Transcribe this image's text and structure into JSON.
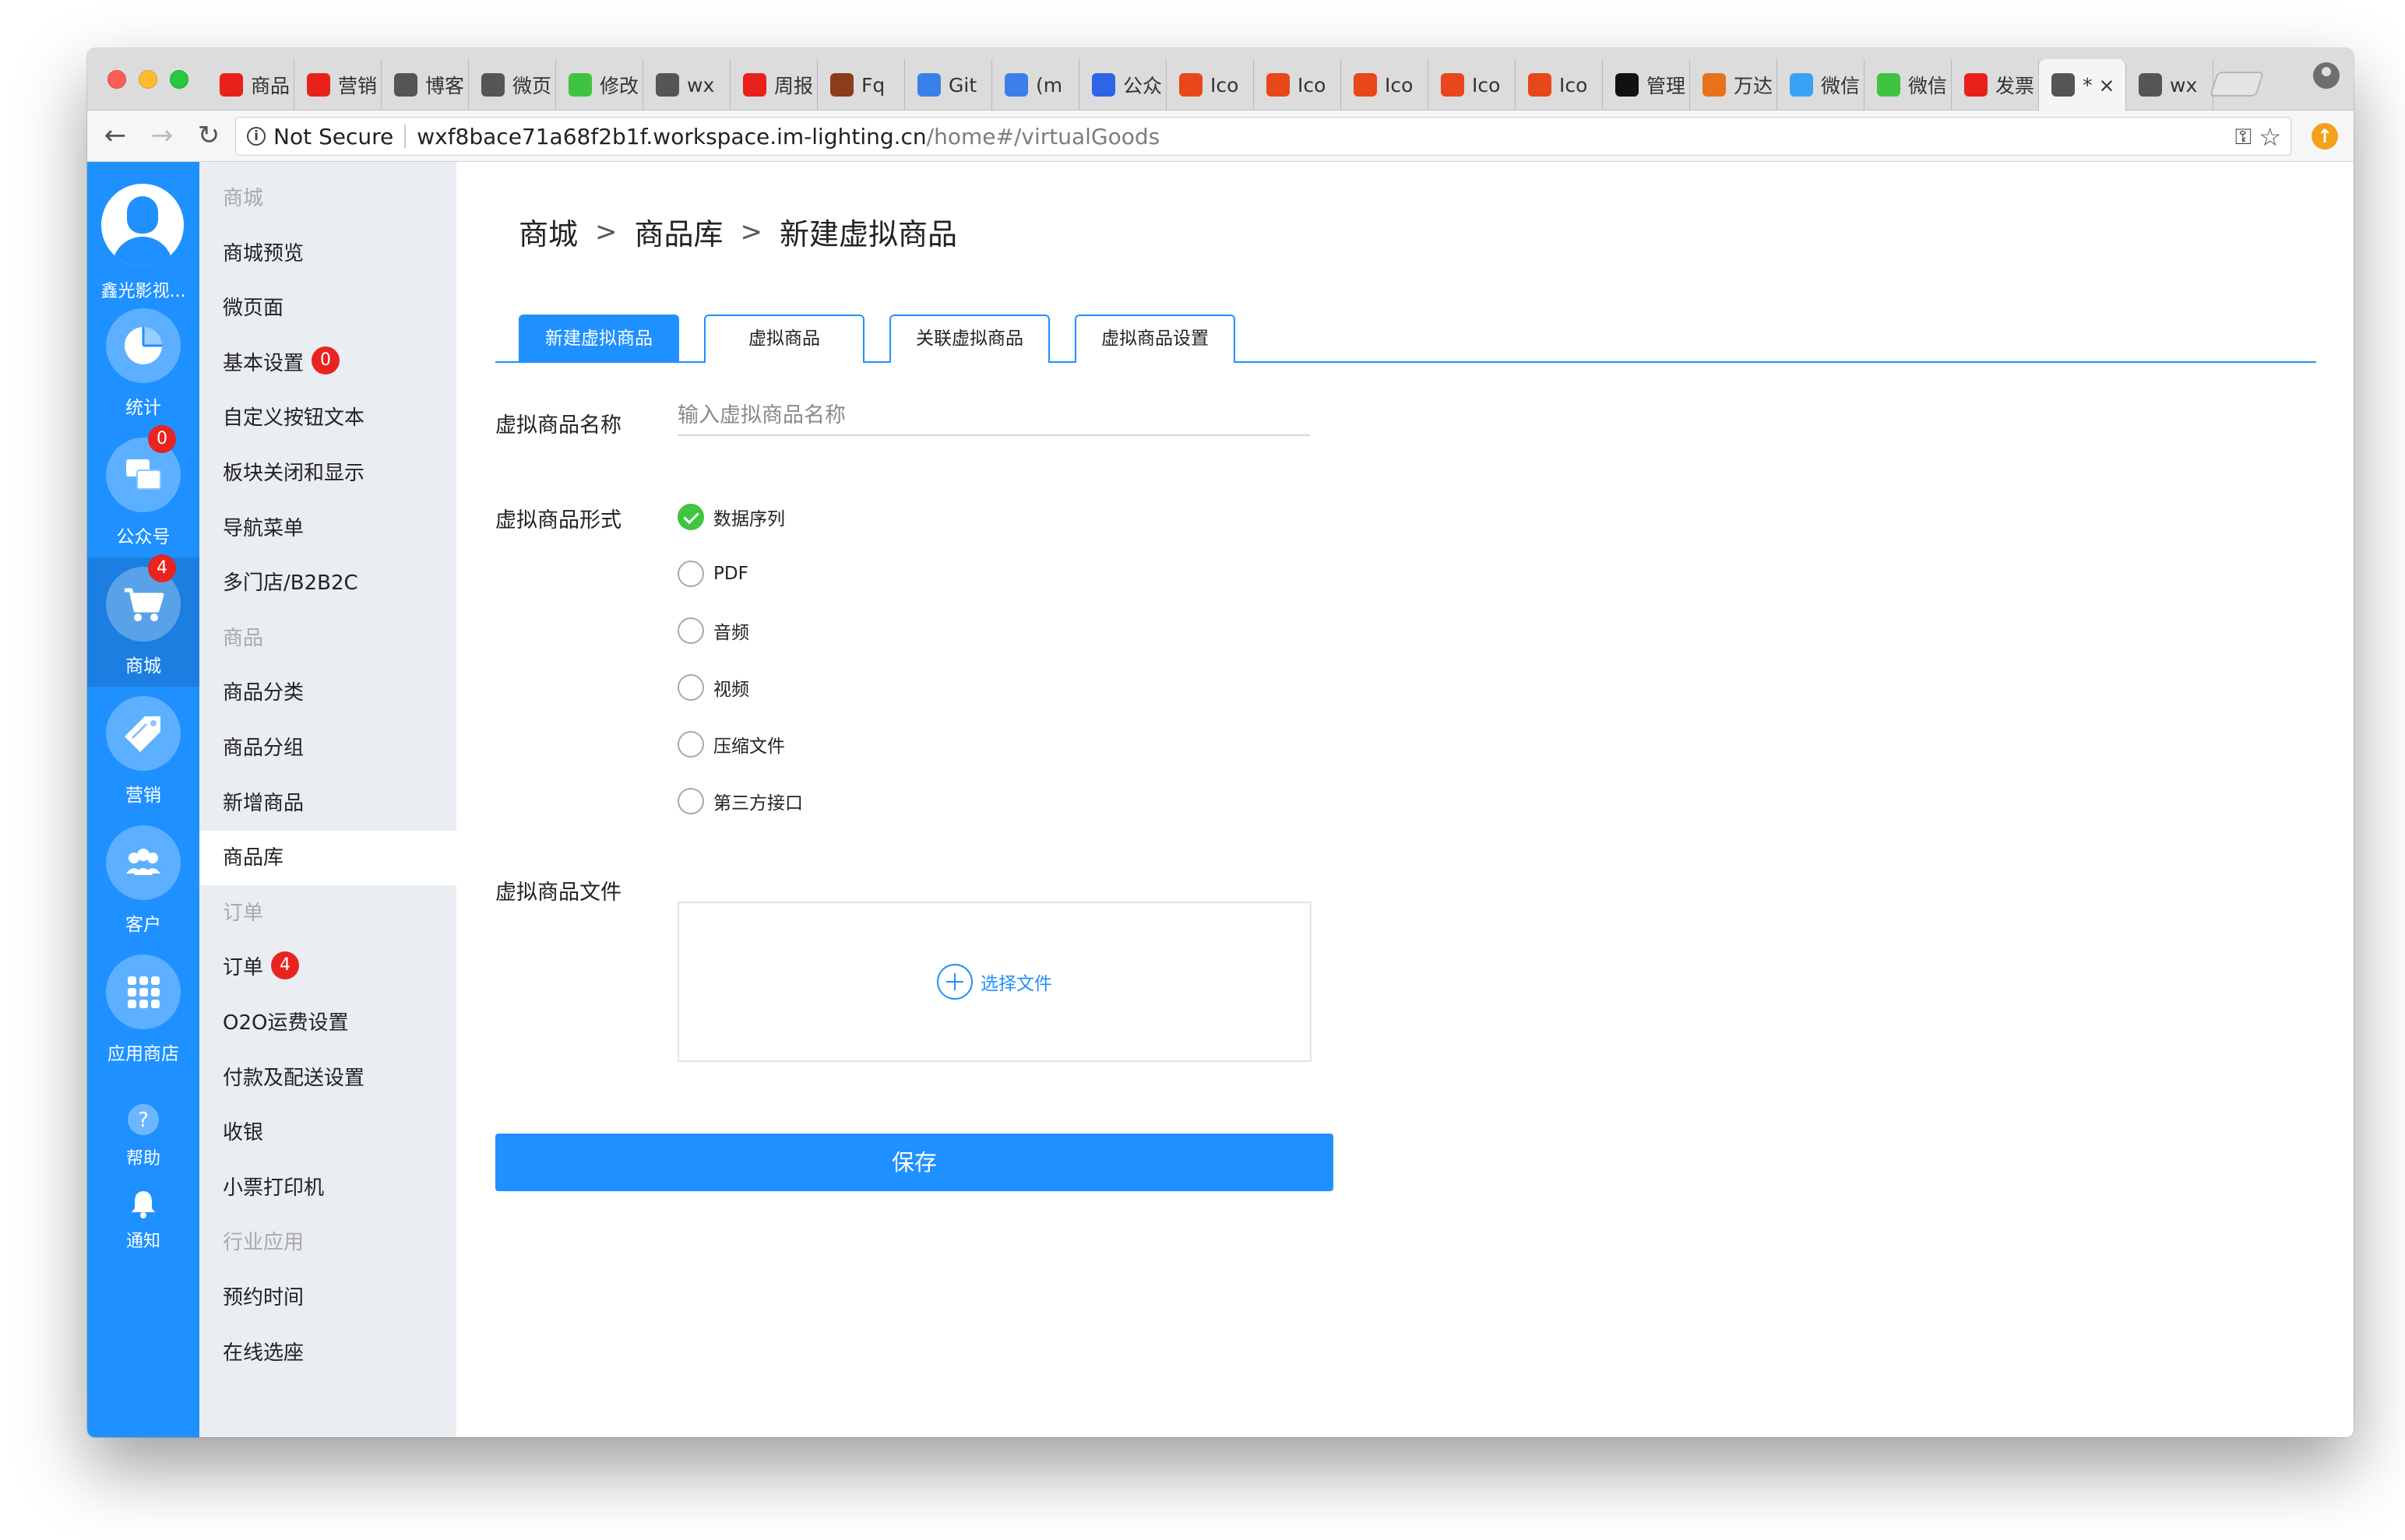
{
  "browser": {
    "tabs": [
      {
        "label": "商品",
        "icon": "thumb-icon",
        "color": "#e8211b"
      },
      {
        "label": "营销",
        "icon": "thumb-icon",
        "color": "#e8211b"
      },
      {
        "label": "博客",
        "icon": "swirl-icon",
        "color": "#555555"
      },
      {
        "label": "微页",
        "icon": "aperture-icon",
        "color": "#555555"
      },
      {
        "label": "修改",
        "icon": "wechat-icon",
        "color": "#3ec43e"
      },
      {
        "label": "wx",
        "icon": "aperture-icon",
        "color": "#555555"
      },
      {
        "label": "周报",
        "icon": "thumb-icon",
        "color": "#e8211b"
      },
      {
        "label": "Fq",
        "icon": "portrait-icon",
        "color": "#8c3b1b"
      },
      {
        "label": "Git",
        "icon": "stack-icon",
        "color": "#3b7fe8"
      },
      {
        "label": "(m",
        "icon": "stack-icon",
        "color": "#3b7fe8"
      },
      {
        "label": "公众",
        "icon": "paw-icon",
        "color": "#2e64e6"
      },
      {
        "label": "Ico",
        "icon": "shield-icon",
        "color": "#e8461b"
      },
      {
        "label": "Ico",
        "icon": "shield-icon",
        "color": "#e8461b"
      },
      {
        "label": "Ico",
        "icon": "shield-icon",
        "color": "#e8461b"
      },
      {
        "label": "Ico",
        "icon": "shield-icon",
        "color": "#e8461b"
      },
      {
        "label": "Ico",
        "icon": "shield-icon",
        "color": "#e8461b"
      },
      {
        "label": "管理",
        "icon": "q-icon",
        "color": "#111111"
      },
      {
        "label": "万达",
        "icon": "fish-icon",
        "color": "#e8721b"
      },
      {
        "label": "微信",
        "icon": "play-icon",
        "color": "#3aa2f5"
      },
      {
        "label": "微信",
        "icon": "wechat-icon",
        "color": "#3ec43e"
      },
      {
        "label": "发票",
        "icon": "thumb-icon",
        "color": "#e8211b"
      },
      {
        "label": "* ×",
        "icon": "aperture-icon",
        "color": "#555555",
        "active": true
      },
      {
        "label": "wx",
        "icon": "aperture-icon",
        "color": "#555555"
      }
    ],
    "url_secure": "Not Secure",
    "url_host": "wxf8bace71a68f2b1f.workspace.im-lighting.cn",
    "url_path": "/home#/virtualGoods"
  },
  "sidebar": {
    "shop_name": "鑫光影视...",
    "items": [
      {
        "label": "统计",
        "icon": "pie-chart-icon",
        "badge": null
      },
      {
        "label": "公众号",
        "icon": "chat-bubbles-icon",
        "badge": "0"
      },
      {
        "label": "商城",
        "icon": "cart-icon",
        "badge": "4"
      },
      {
        "label": "营销",
        "icon": "tag-icon",
        "badge": null
      },
      {
        "label": "客户",
        "icon": "people-icon",
        "badge": null
      },
      {
        "label": "应用商店",
        "icon": "grid-icon",
        "badge": null
      }
    ],
    "help": "帮助",
    "notify": "通知"
  },
  "submenu": [
    {
      "label": "商城",
      "group": true
    },
    {
      "label": "商城预览"
    },
    {
      "label": "微页面"
    },
    {
      "label": "基本设置",
      "badge": "0"
    },
    {
      "label": "自定义按钮文本"
    },
    {
      "label": "板块关闭和显示"
    },
    {
      "label": "导航菜单"
    },
    {
      "label": "多门店/B2B2C"
    },
    {
      "label": "商品",
      "group": true
    },
    {
      "label": "商品分类"
    },
    {
      "label": "商品分组"
    },
    {
      "label": "新增商品"
    },
    {
      "label": "商品库",
      "active": true
    },
    {
      "label": "订单",
      "group": true
    },
    {
      "label": "订单",
      "badge": "4"
    },
    {
      "label": "O2O运费设置"
    },
    {
      "label": "付款及配送设置"
    },
    {
      "label": "收银"
    },
    {
      "label": "小票打印机"
    },
    {
      "label": "行业应用",
      "group": true
    },
    {
      "label": "预约时间"
    },
    {
      "label": "在线选座"
    }
  ],
  "main": {
    "breadcrumb": [
      "商城",
      "商品库",
      "新建虚拟商品"
    ],
    "tabs": [
      {
        "label": "新建虚拟商品",
        "active": true
      },
      {
        "label": "虚拟商品"
      },
      {
        "label": "关联虚拟商品"
      },
      {
        "label": "虚拟商品设置"
      }
    ],
    "name_label": "虚拟商品名称",
    "name_placeholder": "输入虚拟商品名称",
    "name_value": "",
    "form_label": "虚拟商品形式",
    "forms": [
      {
        "label": "数据序列",
        "checked": true
      },
      {
        "label": "PDF"
      },
      {
        "label": "音频"
      },
      {
        "label": "视频"
      },
      {
        "label": "压缩文件"
      },
      {
        "label": "第三方接口"
      }
    ],
    "file_label": "虚拟商品文件",
    "choose_file": "选择文件",
    "save": "保存"
  },
  "colors": {
    "accent": "#1f90ff",
    "badge": "#e9231f",
    "check": "#3fc53f"
  }
}
